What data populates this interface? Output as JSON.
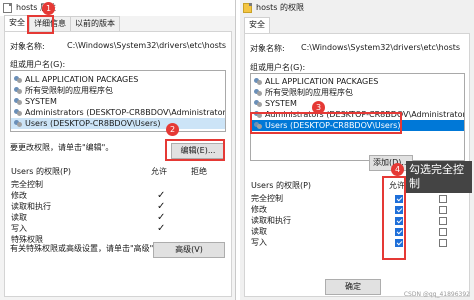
{
  "left": {
    "title": "hosts 属性",
    "tabs": [
      "安全",
      "详细信息",
      "以前的版本"
    ],
    "object_label": "对象名称:",
    "object_path": "C:\\Windows\\System32\\drivers\\etc\\hosts",
    "group_label": "组或用户名(G):",
    "groups": [
      "ALL APPLICATION PACKAGES",
      "所有受限制的应用程序包",
      "SYSTEM",
      "Administrators (DESKTOP-CR8BDOV\\Administrators)",
      "Users (DESKTOP-CR8BDOV\\Users)"
    ],
    "change_hint": "要更改权限，请单击\"编辑\"。",
    "edit_button": "编辑(E)...",
    "perm_header": "Users 的权限(P)",
    "allow_header": "允许",
    "deny_header": "拒绝",
    "permissions": [
      {
        "name": "完全控制",
        "allow": false
      },
      {
        "name": "修改",
        "allow": true
      },
      {
        "name": "读取和执行",
        "allow": true
      },
      {
        "name": "读取",
        "allow": true
      },
      {
        "name": "写入",
        "allow": true
      },
      {
        "name": "特殊权限",
        "allow": false
      }
    ],
    "advanced_hint": "有关特殊权限或高级设置，请单击\"高级\"。",
    "advanced_button": "高级(V)"
  },
  "right": {
    "title": "hosts 的权限",
    "tab": "安全",
    "object_label": "对象名称:",
    "object_path": "C:\\Windows\\System32\\drivers\\etc\\hosts",
    "group_label": "组或用户名(G):",
    "groups": [
      "ALL APPLICATION PACKAGES",
      "所有受限制的应用程序包",
      "SYSTEM",
      "Administrators (DESKTOP-CR8BDOV\\Administrators)",
      "Users (DESKTOP-CR8BDOV\\Users)"
    ],
    "add_button": "添加(D)...",
    "perm_header": "Users 的权限(P)",
    "allow_header": "允许",
    "deny_header": "拒绝",
    "permissions": [
      {
        "name": "完全控制",
        "allow": true,
        "deny": false
      },
      {
        "name": "修改",
        "allow": true,
        "deny": false
      },
      {
        "name": "读取和执行",
        "allow": true,
        "deny": false
      },
      {
        "name": "读取",
        "allow": true,
        "deny": false
      },
      {
        "name": "写入",
        "allow": true,
        "deny": false
      }
    ],
    "ok_button": "确定"
  },
  "annotations": {
    "badges": [
      "1",
      "2",
      "3",
      "4"
    ],
    "note": "勾选完全控制"
  },
  "watermark": "CSDN @qq_41896392",
  "colors": {
    "highlight": "#e53935",
    "selected": "#0078d7",
    "checkbox": "#1e6fd9"
  }
}
